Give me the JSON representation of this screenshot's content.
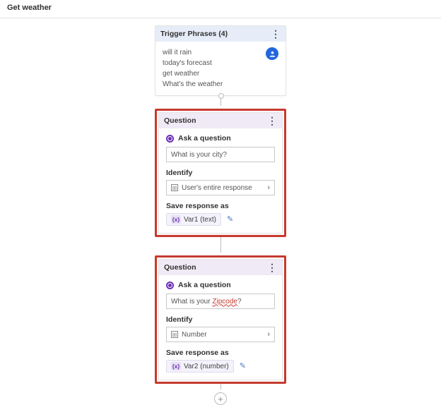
{
  "title": "Get weather",
  "trigger": {
    "header": "Trigger Phrases (4)",
    "phrases": {
      "p0": "will it rain",
      "p1": "today's forecast",
      "p2": "get weather",
      "p3": "What's the weather"
    }
  },
  "q1": {
    "header": "Question",
    "ask_label": "Ask a question",
    "input_value": "What is your city?",
    "identify_label": "Identify",
    "identify_value": "User's entire response",
    "save_label": "Save response as",
    "var_icon": "{x}",
    "var_text": "Var1 (text)"
  },
  "q2": {
    "header": "Question",
    "ask_label": "Ask a question",
    "input_prefix": "What is your ",
    "input_zip": "Zipcode",
    "input_suffix": "?",
    "identify_label": "Identify",
    "identify_value": "Number",
    "save_label": "Save response as",
    "var_icon": "{x}",
    "var_text": "Var2 (number)"
  }
}
